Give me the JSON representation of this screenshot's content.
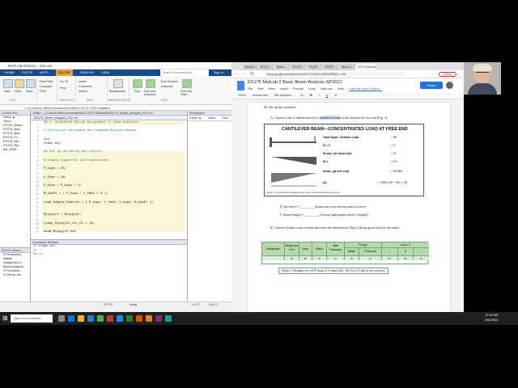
{
  "matlab": {
    "window_title": "MATLAB R2021a - trial use",
    "tabs": [
      "HOME",
      "PLOTS",
      "APPS",
      "EDITOR",
      "PUBLISH",
      "VIEW"
    ],
    "active_tab": "EDITOR",
    "ribbon": {
      "new": "New",
      "open": "Open",
      "save": "Save",
      "find_files": "Find Files",
      "compare": "Compare",
      "print": "Print",
      "go_to": "Go To",
      "find": "Find",
      "insert": "Insert",
      "comment": "Comment",
      "indent": "Indent",
      "breakpoints": "Breakpoints",
      "run": "Run",
      "run_advance": "Run and Advance",
      "run_section": "Run Section",
      "advance": "Advance",
      "run_time": "Run and Time",
      "groups": [
        "FILE",
        "NAVIGATE",
        "EDIT",
        "BREAKPOINTS",
        "RUN"
      ]
    },
    "search_placeholder": "Search Documentation",
    "sign_in": "Sign In",
    "path": "C: ▸ Users ▸ Jeff ▸ Documents ▸ MACC ▸ ES 175 ▸ Matlab ▸",
    "current_folder_title": "Current Fol...",
    "current_folder_items": [
      "Name ▲",
      "Tutori...",
      "ES175_Beam...",
      "ES175_Bea...",
      "ES175_Bea...",
      "ES175_Fr...",
      "ES175_Ma...",
      "ES175_Rip...",
      "bar_Settli..."
    ],
    "details_title": "ES175_Beam_...",
    "details_text": [
      "% Scheduled",
      "Matlab",
      "Assignment 2:",
      "Beam Analysis",
      "",
      "% Schedule...",
      "% Set up var..."
    ],
    "editor_title": "Editor - C:\\Users\\Jeff\\Documents\\MACC\\ES175\\Matlab\\ES175_Beam_analysis_FAC.m*",
    "editor_tab": "ES175_Beam_analysis_FAC.m*",
    "code_lines": [
      {
        "n": "1",
        "text": "%% 2. Scheduled Matlab Assignment 2: Beam Analysis",
        "comment": true
      },
      {
        "n": "2",
        "text": "",
        "comment": false
      },
      {
        "n": "3",
        "text": "% Initialize Workspace and Command/Display Window",
        "comment": true
      },
      {
        "n": "4",
        "text": "",
        "comment": false
      },
      {
        "n": "5",
        "text": "clc",
        "comment": false
      },
      {
        "n": "6",
        "text": "clear all",
        "comment": false
      },
      {
        "n": "7",
        "text": "",
        "comment": false
      },
      {
        "n": "8",
        "text": "%% Set up variables and vectors",
        "comment": true
      },
      {
        "n": "9",
        "text": "",
        "comment": false
      },
      {
        "n": "10",
        "text": "% Simply-supported (not cantilever)",
        "comment": true
      },
      {
        "n": "11",
        "text": "",
        "comment": false
      },
      {
        "n": "12",
        "text": "P_kips = 25;",
        "comment": false
      },
      {
        "n": "13",
        "text": "",
        "comment": false
      },
      {
        "n": "14",
        "text": "L_feet = 10;",
        "comment": false
      },
      {
        "n": "15",
        "text": "",
        "comment": false
      },
      {
        "n": "16",
        "text": "V_kips = P_kips / 2;",
        "comment": false
      },
      {
        "n": "17",
        "text": "",
        "comment": false
      },
      {
        "n": "18",
        "text": "M_kipFt = ( P_kips * L_feet / 4 );",
        "comment": false
      },
      {
        "n": "19",
        "text": "",
        "comment": false
      },
      {
        "n": "20",
        "text": "Load_Simple_Central = [ P_kips, L_feet, V_kips, M_kipFt ];",
        "comment": false
      },
      {
        "n": "21",
        "text": "",
        "comment": false
      },
      {
        "n": "22",
        "text": "",
        "comment": false
      },
      {
        "n": "23",
        "text": "M(kip)ft = M(kip)ft;",
        "comment": false
      },
      {
        "n": "24",
        "text": "",
        "comment": false
      },
      {
        "n": "25",
        "text": "L(mm)_M(kip)ft_for_Ft = 10;",
        "comment": false
      },
      {
        "n": "26",
        "text": "",
        "comment": false
      },
      {
        "n": "27",
        "text": "Area_M(kip)ft_in2",
        "comment": false
      }
    ],
    "command_title": "Command Window",
    "command_lines": [
      ">> clear all",
      ">>",
      "fx >>"
    ],
    "workspace_title": "Workspace",
    "workspace_cols": [
      "Name ▲",
      "Value",
      "Size"
    ],
    "status": {
      "encoding": "UTF-8",
      "lang": "script",
      "ln": "Ln 27",
      "col": "Col 17"
    }
  },
  "chrome": {
    "tabs": [
      "Search t...",
      "ES175 ...",
      "Beam ...",
      "ES175 ...",
      "ES175 ...",
      "ES175 ...",
      "Beam C...",
      "ES175 MatLab 2..."
    ],
    "url": "docs.google.com/document/d/1t7LTMlJJoYkBGaPf5bCi...edit",
    "update": "Update",
    "doc_title": "ES175 MatLab 2 Basic Beam Analysis SP2021",
    "menu": [
      "File",
      "Edit",
      "View",
      "Insert",
      "Format",
      "Tools",
      "Add-ons",
      "Help"
    ],
    "last_edit": "Last edit was 5 minut...",
    "share": "Share",
    "toolbar": [
      "100%",
      "Normal text",
      "Bill Gardens...",
      "11",
      "B",
      "I",
      "U",
      "A"
    ],
    "section": "III.    Set up the variables",
    "item_a": "A.   Choose a set of dimensions for a",
    "item_a_hl": "cantilever beam",
    "item_a_tail": "with a load at its free end (Fig. 1).",
    "fig1_title": "CANTILEVER BEAM—CONCENTRATED LOAD AT FREE END",
    "fig1_rows": [
      {
        "l": "Total Equiv. Uniform Load",
        "r": "= 8P"
      },
      {
        "l": "R = V",
        "r": "= P"
      },
      {
        "l": "M max. (at fixed end)",
        "r": "= Pl"
      },
      {
        "l": "M x",
        "r": "= Px"
      },
      {
        "l": "Δmax. (at free end)",
        "r": "= Pl³/3EI"
      },
      {
        "l": "Δx",
        "r": "= P/6EI (2l³ − 3l²x + x³)"
      }
    ],
    "fig1_caption": "Figure 1: Formulas for cantilever beam with concentrated load at free end.",
    "p_line": "P (the force) = ________ (make sure you choose units of force)",
    "l_line": "L (beam length) = ________ (choose appropriate units of length)",
    "item_b": "B.   Choose a beam cross-section and enter the dimensions (Fig.2) (keep good track of the units):",
    "table_headers": [
      "Designation",
      "Weight per Foot",
      "Area",
      "Depth",
      "Web Thickness",
      "Width",
      "Thickness",
      "I",
      "S",
      "r"
    ],
    "table_units": [
      "",
      "lb",
      "in²",
      "in",
      "in",
      "in",
      "in",
      "in⁴",
      "in³",
      "in"
    ],
    "flange_label": "Flange",
    "axis_label": "Axis 1-1",
    "fig2_caption": "Figure 2: Headings for real W-shape or S-shape table. The Axis 2-2 data is not necessary."
  },
  "taskbar": {
    "search": "Type here to search",
    "time": "12:22 AM",
    "date": "4/30/2021"
  }
}
